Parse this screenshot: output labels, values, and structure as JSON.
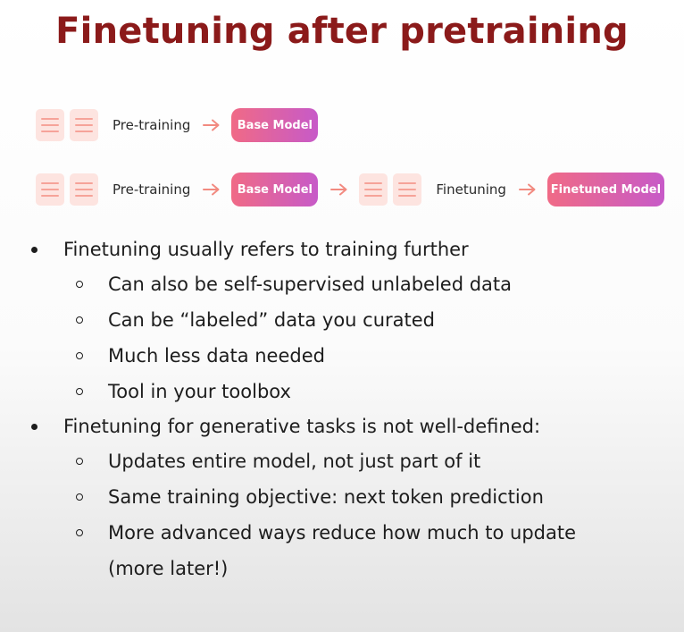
{
  "slide": {
    "title": "Finetuning after pretraining"
  },
  "flow": {
    "row1": {
      "stage_label": "Pre-training",
      "model_label": "Base Model"
    },
    "row2": {
      "stage1_label": "Pre-training",
      "model1_label": "Base Model",
      "stage2_label": "Finetuning",
      "model2_label": "Finetuned Model"
    }
  },
  "bullets": [
    {
      "text": "Finetuning usually refers to training further",
      "sub": [
        "Can also be self-supervised unlabeled data",
        "Can be “labeled” data you curated",
        "Much less data needed",
        "Tool in your toolbox"
      ]
    },
    {
      "text": "Finetuning for generative tasks is not well-defined:",
      "sub": [
        "Updates entire model, not just part of it",
        "Same training objective: next token prediction",
        "More advanced ways reduce how much to update (more later!)"
      ]
    }
  ],
  "colors": {
    "title": "#8b1a1a",
    "model_gradient_start": "#f06a86",
    "model_gradient_end": "#c75ac8",
    "data_icon_bg": "#fde4e0",
    "data_icon_line": "#f6a399",
    "arrow": "#f28a80"
  },
  "icons": {
    "data": "data-document-icon",
    "arrow": "arrow-right-icon"
  }
}
